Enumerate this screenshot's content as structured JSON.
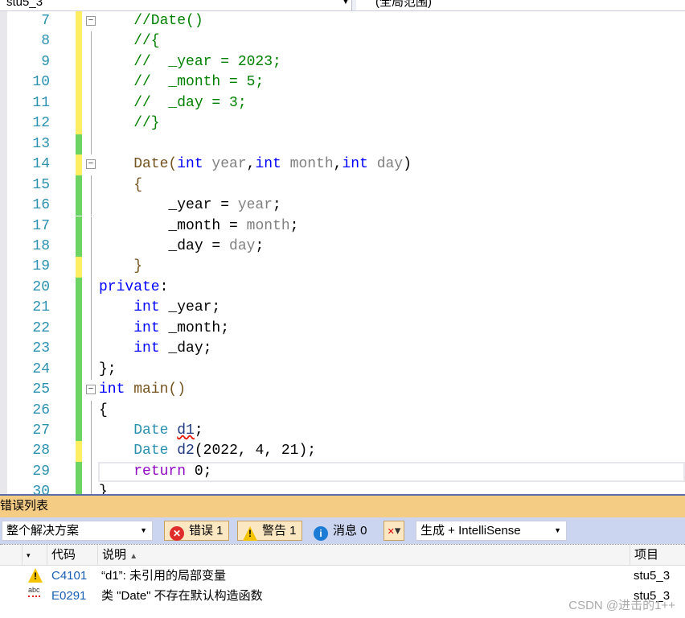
{
  "topbar": {
    "project": "stu5_3",
    "scope": "(全局范围)"
  },
  "editor": {
    "lines": [
      {
        "n": "7",
        "g": "y",
        "fold": true,
        "t": [
          [
            "    //Date()",
            "c-comment"
          ]
        ]
      },
      {
        "n": "8",
        "g": "y",
        "t": [
          [
            "    //{",
            "c-comment"
          ]
        ]
      },
      {
        "n": "9",
        "g": "y",
        "t": [
          [
            "    //  _year = 2023;",
            "c-comment"
          ]
        ]
      },
      {
        "n": "10",
        "g": "y",
        "t": [
          [
            "    //  _month = 5;",
            "c-comment"
          ]
        ]
      },
      {
        "n": "11",
        "g": "y",
        "t": [
          [
            "    //  _day = 3;",
            "c-comment"
          ]
        ]
      },
      {
        "n": "12",
        "g": "y",
        "t": [
          [
            "    //}",
            "c-comment"
          ]
        ]
      },
      {
        "n": "13",
        "g": "g",
        "t": []
      },
      {
        "n": "14",
        "g": "y",
        "fold": true,
        "t": [
          [
            "    Date(",
            "c-func"
          ],
          [
            "int",
            "c-kw"
          ],
          [
            " year",
            "c-param"
          ],
          [
            ",",
            ""
          ],
          [
            "int",
            "c-kw"
          ],
          [
            " month",
            "c-param"
          ],
          [
            ",",
            ""
          ],
          [
            "int",
            "c-kw"
          ],
          [
            " day",
            "c-param"
          ],
          [
            ")",
            ""
          ]
        ]
      },
      {
        "n": "15",
        "g": "g",
        "t": [
          [
            "    {",
            "c-func"
          ]
        ]
      },
      {
        "n": "16",
        "g": "g",
        "t": [
          [
            "        _year = ",
            ""
          ],
          [
            "year",
            "c-param"
          ],
          [
            ";",
            ""
          ]
        ]
      },
      {
        "n": "17",
        "g": "g",
        "t": [
          [
            "        _month = ",
            ""
          ],
          [
            "month",
            "c-param"
          ],
          [
            ";",
            ""
          ]
        ]
      },
      {
        "n": "18",
        "g": "g",
        "t": [
          [
            "        _day = ",
            ""
          ],
          [
            "day",
            "c-param"
          ],
          [
            ";",
            ""
          ]
        ]
      },
      {
        "n": "19",
        "g": "y",
        "t": [
          [
            "    }",
            "c-func"
          ]
        ]
      },
      {
        "n": "20",
        "g": "g",
        "t": [
          [
            "private",
            "c-kw"
          ],
          [
            ":",
            ""
          ]
        ]
      },
      {
        "n": "21",
        "g": "g",
        "t": [
          [
            "    ",
            ""
          ],
          [
            "int",
            "c-kw"
          ],
          [
            " _year;",
            ""
          ]
        ]
      },
      {
        "n": "22",
        "g": "g",
        "t": [
          [
            "    ",
            ""
          ],
          [
            "int",
            "c-kw"
          ],
          [
            " _month;",
            ""
          ]
        ]
      },
      {
        "n": "23",
        "g": "g",
        "t": [
          [
            "    ",
            ""
          ],
          [
            "int",
            "c-kw"
          ],
          [
            " _day;",
            ""
          ]
        ]
      },
      {
        "n": "24",
        "g": "g",
        "t": [
          [
            "};",
            ""
          ]
        ]
      },
      {
        "n": "25",
        "g": "g",
        "fold": true,
        "t": [
          [
            "int",
            "c-kw"
          ],
          [
            " main()",
            "c-func"
          ]
        ]
      },
      {
        "n": "26",
        "g": "g",
        "t": [
          [
            "{",
            ""
          ]
        ]
      },
      {
        "n": "27",
        "g": "g",
        "t": [
          [
            "    ",
            ""
          ],
          [
            "Date",
            "c-type"
          ],
          [
            " ",
            ""
          ],
          [
            "d1",
            "c-var squig"
          ],
          [
            ";",
            ""
          ]
        ]
      },
      {
        "n": "28",
        "g": "y",
        "t": [
          [
            "    ",
            ""
          ],
          [
            "Date",
            "c-type"
          ],
          [
            " ",
            ""
          ],
          [
            "d2",
            "c-var"
          ],
          [
            "(2022, 4, 21);",
            ""
          ]
        ]
      },
      {
        "n": "29",
        "g": "g",
        "cur": true,
        "t": [
          [
            "    ",
            ""
          ],
          [
            "return",
            "c-ctl"
          ],
          [
            " 0;",
            ""
          ]
        ]
      },
      {
        "n": "30",
        "g": "g",
        "t": [
          [
            "}",
            ""
          ]
        ]
      }
    ]
  },
  "colors": {
    "gutter_yellow": "#ffee62",
    "gutter_green": "#6ed365",
    "panel_title": "#f5cc84",
    "toolbar": "#ccd5f0"
  },
  "errorlist": {
    "title": "错误列表",
    "scope": "整个解决方案",
    "errors": "错误 1",
    "warnings": "警告 1",
    "messages": "消息 0",
    "source": "生成 + IntelliSense",
    "headers": {
      "code": "代码",
      "desc": "说明",
      "project": "项目"
    },
    "rows": [
      {
        "icon": "warning-icon",
        "code": "C4101",
        "desc": "“d1”: 未引用的局部变量",
        "project": "stu5_3"
      },
      {
        "icon": "intellisense-error-icon",
        "code": "E0291",
        "desc": "类 \"Date\" 不存在默认构造函数",
        "project": "stu5_3"
      }
    ]
  },
  "watermark": "CSDN @进击的1++"
}
